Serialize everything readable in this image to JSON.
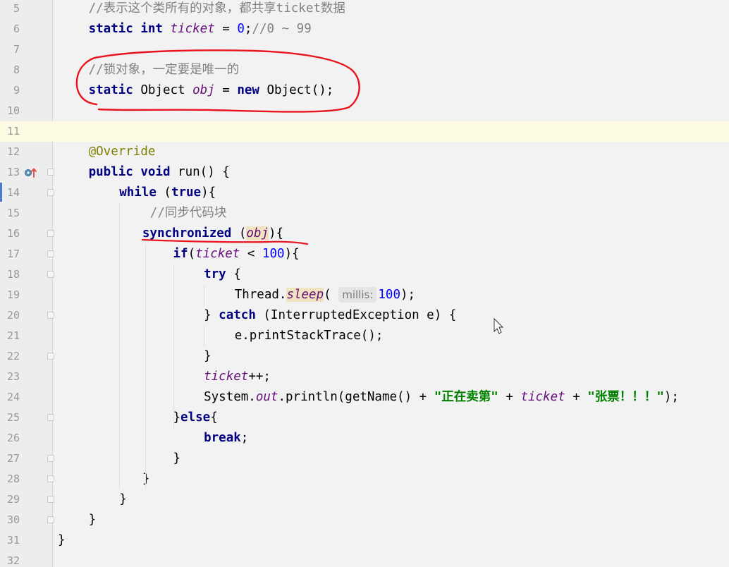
{
  "editor": {
    "colors": {
      "background": "#f2f2f2",
      "gutter": "#ededed",
      "keyword": "#000080",
      "field": "#660e7a",
      "number": "#0000ff",
      "string": "#008000",
      "comment": "#808080",
      "annotation": "#808000",
      "current_line": "#fdfce3",
      "annotation_ink": "#e8141e"
    },
    "icons": {
      "line13": "override-method-icon"
    },
    "lines": [
      {
        "n": "5",
        "tokens": [
          [
            "cmt",
            "//"
          ],
          [
            "cmt-zh",
            "表示这个类所有的对象，都共享"
          ],
          [
            "cmt",
            "ticket"
          ],
          [
            "cmt-zh",
            "数据"
          ]
        ]
      },
      {
        "n": "6",
        "tokens": [
          [
            "kw",
            "static"
          ],
          [
            "",
            " "
          ],
          [
            "kw",
            "int"
          ],
          [
            "",
            " "
          ],
          [
            "field",
            "ticket"
          ],
          [
            "",
            " = "
          ],
          [
            "num",
            "0"
          ],
          [
            "",
            ";"
          ],
          [
            "cmt",
            "//0 ~ 99"
          ]
        ]
      },
      {
        "n": "7",
        "tokens": []
      },
      {
        "n": "8",
        "tokens": [
          [
            "cmt",
            "//"
          ],
          [
            "cmt-zh",
            "锁对象，一定要是唯一的"
          ]
        ]
      },
      {
        "n": "9",
        "tokens": [
          [
            "kw",
            "static"
          ],
          [
            "",
            " Object "
          ],
          [
            "field",
            "obj"
          ],
          [
            "",
            " = "
          ],
          [
            "kw",
            "new"
          ],
          [
            "",
            " Object();"
          ]
        ]
      },
      {
        "n": "10",
        "tokens": []
      },
      {
        "n": "11",
        "tokens": []
      },
      {
        "n": "12",
        "tokens": [
          [
            "ann",
            "@Override"
          ]
        ]
      },
      {
        "n": "13",
        "tokens": [
          [
            "kw",
            "public"
          ],
          [
            "",
            " "
          ],
          [
            "kw",
            "void"
          ],
          [
            "",
            " run() {"
          ]
        ]
      },
      {
        "n": "14",
        "tokens": [
          [
            "kw",
            "while"
          ],
          [
            "",
            " ("
          ],
          [
            "kw",
            "true"
          ],
          [
            "",
            "){"
          ]
        ]
      },
      {
        "n": "15",
        "tokens": [
          [
            "cmt",
            "//"
          ],
          [
            "cmt-zh",
            "同步代码块"
          ]
        ]
      },
      {
        "n": "16",
        "tokens": [
          [
            "kw",
            "synchronized"
          ],
          [
            "",
            " ("
          ],
          [
            "field hl",
            "obj"
          ],
          [
            "",
            "){"
          ]
        ]
      },
      {
        "n": "17",
        "tokens": [
          [
            "kw",
            "if"
          ],
          [
            "",
            "("
          ],
          [
            "field",
            "ticket"
          ],
          [
            "",
            " < "
          ],
          [
            "num",
            "100"
          ],
          [
            "",
            "){"
          ]
        ]
      },
      {
        "n": "18",
        "tokens": [
          [
            "kw",
            "try"
          ],
          [
            "",
            " {"
          ]
        ]
      },
      {
        "n": "19",
        "tokens": [
          [
            "",
            "Thread."
          ],
          [
            "field hl",
            "sleep"
          ],
          [
            "",
            "( "
          ],
          [
            "hint",
            "millis:"
          ],
          [
            "num",
            "100"
          ],
          [
            "",
            ");"
          ]
        ]
      },
      {
        "n": "20",
        "tokens": [
          [
            "",
            "} "
          ],
          [
            "kw",
            "catch"
          ],
          [
            "",
            " (InterruptedException e) {"
          ]
        ]
      },
      {
        "n": "21",
        "tokens": [
          [
            "",
            "e.printStackTrace();"
          ]
        ]
      },
      {
        "n": "22",
        "tokens": [
          [
            "",
            "}"
          ]
        ]
      },
      {
        "n": "23",
        "tokens": [
          [
            "field",
            "ticket"
          ],
          [
            "",
            "++;"
          ]
        ]
      },
      {
        "n": "24",
        "tokens": [
          [
            "",
            "System."
          ],
          [
            "field",
            "out"
          ],
          [
            "",
            ".println(getName() + "
          ],
          [
            "str",
            "\""
          ],
          [
            "str zh-str",
            "正在卖第"
          ],
          [
            "str",
            "\""
          ],
          [
            "",
            " + "
          ],
          [
            "field",
            "ticket"
          ],
          [
            "",
            " + "
          ],
          [
            "str",
            "\""
          ],
          [
            "str zh-str",
            "张票！！！"
          ],
          [
            "str",
            "\""
          ],
          [
            "",
            ");"
          ]
        ]
      },
      {
        "n": "25",
        "tokens": [
          [
            "",
            "}"
          ],
          [
            "kw",
            "else"
          ],
          [
            "",
            "{"
          ]
        ]
      },
      {
        "n": "26",
        "tokens": [
          [
            "kw",
            "break"
          ],
          [
            "",
            ";"
          ]
        ]
      },
      {
        "n": "27",
        "tokens": [
          [
            "",
            "}"
          ]
        ]
      },
      {
        "n": "28",
        "tokens": [
          [
            "",
            "}"
          ]
        ]
      },
      {
        "n": "29",
        "tokens": [
          [
            "",
            "}"
          ]
        ]
      },
      {
        "n": "30",
        "tokens": [
          [
            "",
            "}"
          ]
        ]
      },
      {
        "n": "31",
        "tokens": [
          [
            "",
            "}"
          ]
        ]
      },
      {
        "n": "32",
        "tokens": []
      }
    ]
  }
}
